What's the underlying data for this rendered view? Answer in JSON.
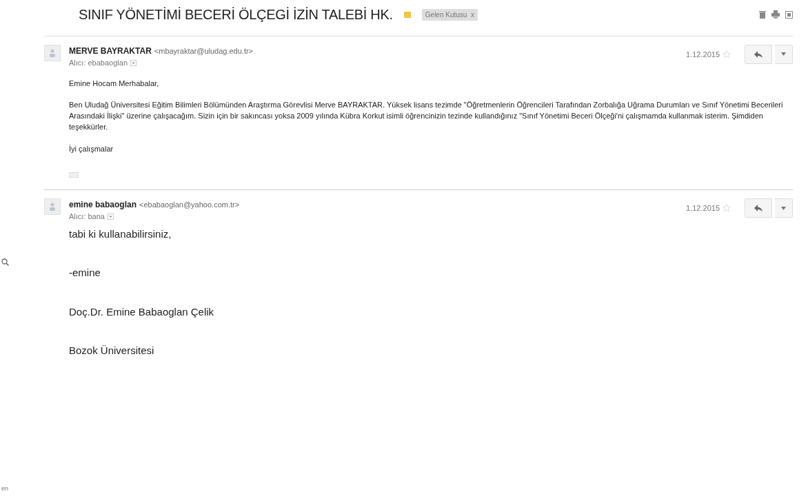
{
  "thread": {
    "subject": "SINIF YÖNETİMİ BECERİ ÖLÇEGİ İZİN TALEBİ HK.",
    "important": true,
    "label": {
      "text": "Gelen Kutusu",
      "remove": "x"
    }
  },
  "side": {
    "footer": "en"
  },
  "messages": [
    {
      "sender": "MERVE BAYRAKTAR",
      "email": "<mbayraktar@uludag.edu.tr>",
      "to": "Alıcı: ebabaoglan",
      "date": "1.12.2015",
      "starred": false,
      "kind": "small",
      "paragraphs": [
        "Emine Hocam Merhabalar,",
        "Ben Uludağ Üniversitesi Eğitim Bilimleri Bölümünden Araştırma Görevlisi Merve BAYRAKTAR. Yüksek lisans tezimde \"Öğretmenlerin Öğrencileri Tarafından Zorbalığa Uğrama Durumları ve Sınıf Yönetimi Becerileri Arasındaki İlişki\" üzerine çalışacağım. Sizin için bir sakıncası yoksa 2009 yılında Kübra Korkut isimli öğrencinizin tezinde kullandığınız \"Sınıf Yönetimi Beceri Ölçeği'ni çalışmamda kullanmak isterim. Şimdiden teşekkürler.",
        "İyi çalışmalar"
      ],
      "trimmed": true
    },
    {
      "sender": "emine babaoglan",
      "email": "<ebabaoglan@yahoo.com.tr>",
      "to": "Alıcı: bana",
      "date": "1.12.2015",
      "starred": false,
      "kind": "large",
      "paragraphs": [
        "tabi ki kullanabilirsiniz,",
        "-emine",
        "Doç.Dr. Emine Babaoglan Çelik",
        "Bozok Üniversitesi"
      ],
      "trimmed": false
    }
  ]
}
